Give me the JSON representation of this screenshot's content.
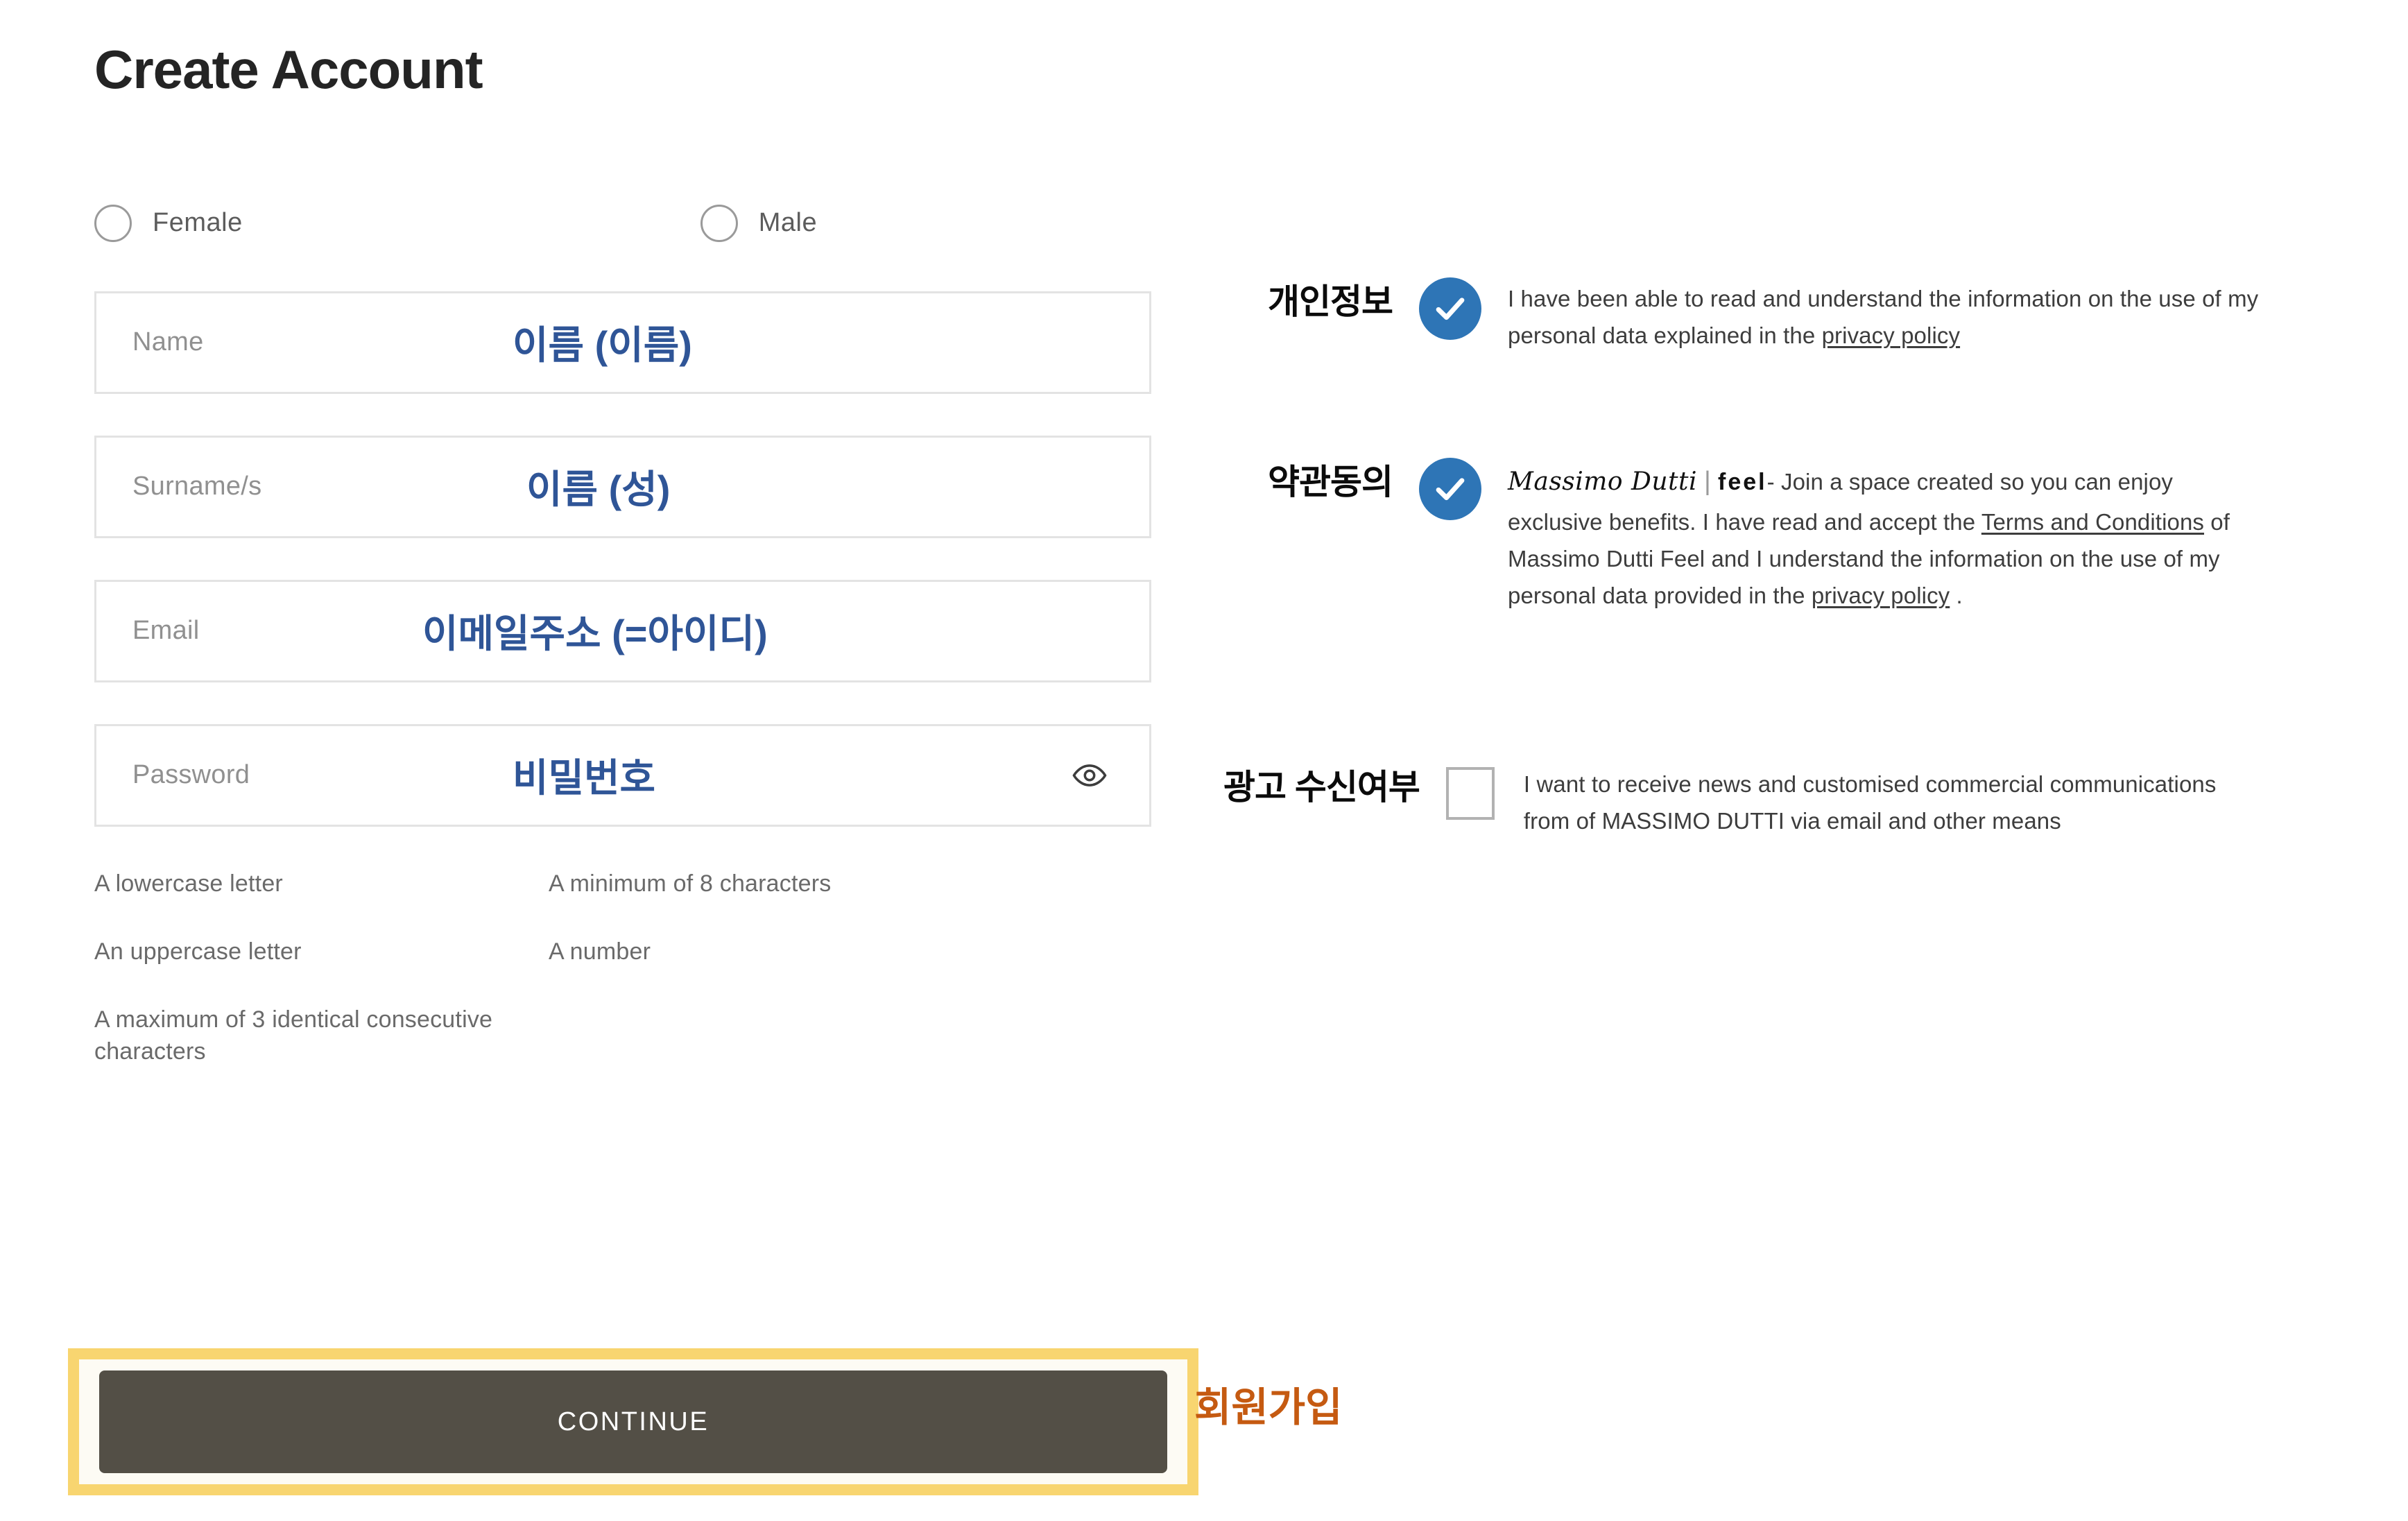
{
  "page": {
    "title": "Create Account"
  },
  "gender": {
    "options": [
      {
        "label": "Female",
        "selected": false
      },
      {
        "label": "Male",
        "selected": false
      }
    ]
  },
  "form": {
    "fields": [
      {
        "placeholder": "Name",
        "value": "",
        "annotation": "이름 (이름)"
      },
      {
        "placeholder": "Surname/s",
        "value": "",
        "annotation": "이름 (성)"
      },
      {
        "placeholder": "Email",
        "value": "",
        "annotation": "이메일주소 (=아이디)"
      },
      {
        "placeholder": "Password",
        "value": "",
        "annotation": "비밀번호",
        "icon": "eye-icon"
      }
    ],
    "password_requirements": [
      "A lowercase letter",
      "An uppercase letter",
      "A maximum of 3 identical consecutive characters",
      "A minimum of 8 characters",
      "A number"
    ]
  },
  "submit": {
    "label": "CONTINUE",
    "annotation": "회원가입",
    "highlight_color": "#F8D570",
    "button_color": "#534F46"
  },
  "consents": [
    {
      "korean_label": "개인정보",
      "checked": true,
      "text_before_link": "I have been able to read and understand the information on the use of my personal data explained in the ",
      "link": "privacy policy",
      "text_after_link": ""
    },
    {
      "korean_label": "약관동의",
      "checked": true,
      "brand_name": "Massimo Dutti",
      "brand_separator": "|",
      "brand_sub": "feel",
      "text_before_link": "- Join a space created so you can enjoy exclusive benefits. I have read and accept the ",
      "link": "Terms and Conditions",
      "text_middle": " of Massimo Dutti Feel and I understand the information on the use of my personal data provided in the ",
      "link2": "privacy policy",
      "text_after_link": " ."
    },
    {
      "korean_label": "광고 수신여부",
      "checked": false,
      "text_before_link": "I want to receive news and customised commercial communications from of MASSIMO DUTTI via email and other means",
      "link": "",
      "text_after_link": ""
    }
  ],
  "colors": {
    "annotation_blue": "#2F5597",
    "annotation_orange": "#C55A11",
    "checkbox_blue": "#2E75B6",
    "highlight_yellow": "#F8D570"
  }
}
